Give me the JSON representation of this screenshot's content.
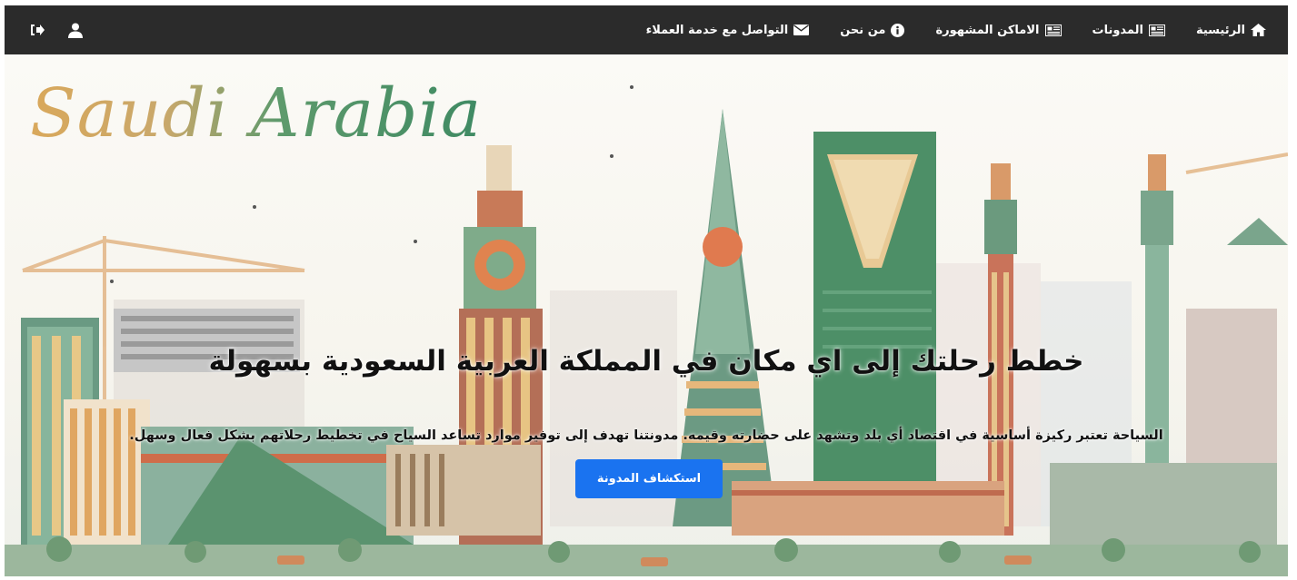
{
  "nav": {
    "items": [
      {
        "label": "الرئيسية",
        "icon": "home-icon"
      },
      {
        "label": "المدونات",
        "icon": "newspaper-icon"
      },
      {
        "label": "الاماكن المشهورة",
        "icon": "newspaper-icon"
      },
      {
        "label": "من نحن",
        "icon": "info-circle-icon"
      },
      {
        "label": "التواصل مع خدمة العملاء",
        "icon": "envelope-icon"
      }
    ],
    "user_icon": "user-icon",
    "logout_icon": "sign-out-icon"
  },
  "hero": {
    "brand": "Saudi Arabia",
    "title": "خطط رحلتك إلى اي مكان في المملكة العربية السعودية بسهولة",
    "subtitle": "السياحة تعتبر ركيزة أساسية في اقتصاد أي بلد وتشهد على حضارته وقيمه. مدونتنا تهدف إلى توفير موارد تساعد السياح في تخطيط رحلاتهم بشكل فعال وسهل.",
    "button_label": "استكشاف المدونة"
  },
  "colors": {
    "navbar_bg": "#2b2b2b",
    "button_bg": "#1a73f0",
    "accent_green": "#3f8a63",
    "accent_gold": "#d9a85b"
  }
}
